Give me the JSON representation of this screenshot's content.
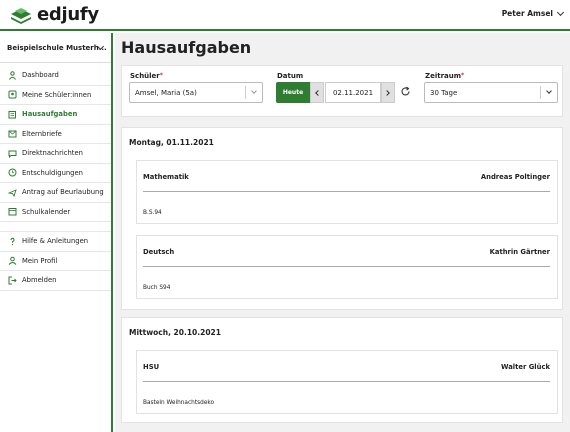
{
  "app": {
    "name": "edjufy"
  },
  "user": {
    "name": "Peter Amsel"
  },
  "sidebar": {
    "school": "Beispielschule Musterh...",
    "items": [
      {
        "label": "Dashboard",
        "icon": "person-icon"
      },
      {
        "label": "Meine Schüler:innen",
        "icon": "students-icon"
      },
      {
        "label": "Hausaufgaben",
        "icon": "book-icon",
        "active": true
      },
      {
        "label": "Elternbriefe",
        "icon": "letter-icon"
      },
      {
        "label": "Direktnachrichten",
        "icon": "chat-icon"
      },
      {
        "label": "Entschuldigungen",
        "icon": "clock-icon"
      },
      {
        "label": "Antrag auf Beurlaubung",
        "icon": "plane-icon"
      },
      {
        "label": "Schulkalender",
        "icon": "calendar-icon"
      }
    ],
    "bottom_items": [
      {
        "label": "Hilfe & Anleitungen",
        "icon": "help-icon"
      },
      {
        "label": "Mein Profil",
        "icon": "profile-icon"
      },
      {
        "label": "Abmelden",
        "icon": "logout-icon"
      }
    ]
  },
  "page": {
    "title": "Hausaufgaben"
  },
  "filters": {
    "student_label": "Schüler",
    "student_value": "Amsel, Maria (5a)",
    "date_label": "Datum",
    "today_label": "Heute",
    "date_value": "02.11.2021",
    "range_label": "Zeitraum",
    "range_value": "30 Tage",
    "required_mark": "*"
  },
  "days": [
    {
      "title": "Montag, 01.11.2021",
      "homework": [
        {
          "subject": "Mathematik",
          "teacher": "Andreas Poltinger",
          "description": "B.S.94"
        },
        {
          "subject": "Deutsch",
          "teacher": "Kathrin Gärtner",
          "description": "Buch S94"
        }
      ]
    },
    {
      "title": "Mittwoch, 20.10.2021",
      "homework": [
        {
          "subject": "HSU",
          "teacher": "Walter Glück",
          "description": "Basteln Weihnachtsdeko"
        }
      ]
    }
  ],
  "colors": {
    "brand": "#2e7d32",
    "required": "#d32f2f"
  }
}
